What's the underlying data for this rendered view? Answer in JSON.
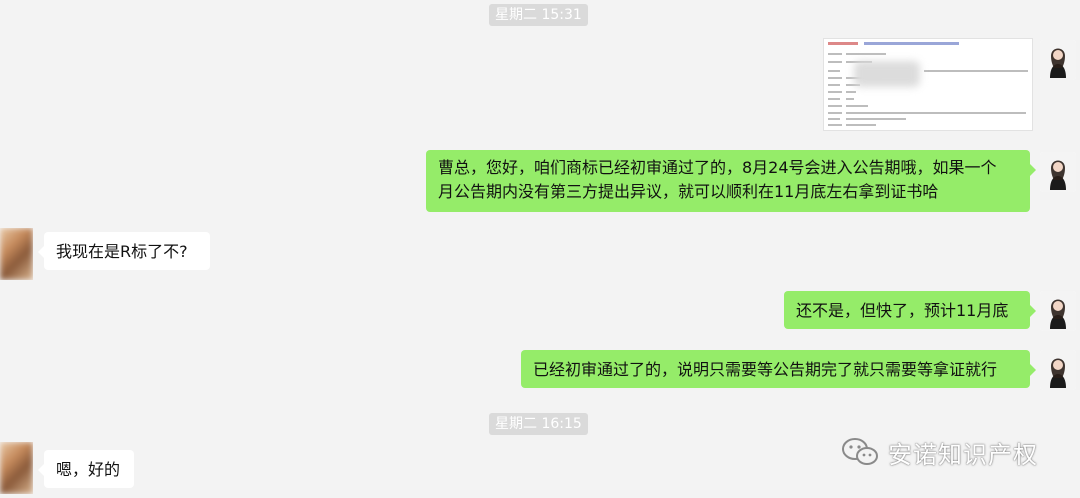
{
  "timestamps": [
    "星期二 15:31",
    "星期二 16:15"
  ],
  "messages": {
    "m1_line1": "曹总，您好，咱们商标已经初审通过了的，8月24号会进入公告期哦，如果一个",
    "m1_line2": "月公告期内没有第三方提出异议，就可以顺利在11月底左右拿到证书哈",
    "m2": "我现在是R标了不?",
    "m3": "还不是，但快了，预计11月底",
    "m4": "已经初审通过了的，说明只需要等公告期完了就只需要等拿证就行",
    "m5": "嗯，好的"
  },
  "watermark": {
    "text": "安诺知识产权",
    "icon": "wechat-icon"
  },
  "colors": {
    "background": "#f3f3f3",
    "bubble_out": "#95ec69",
    "bubble_in": "#ffffff",
    "timestamp_bg": "#dadada"
  }
}
